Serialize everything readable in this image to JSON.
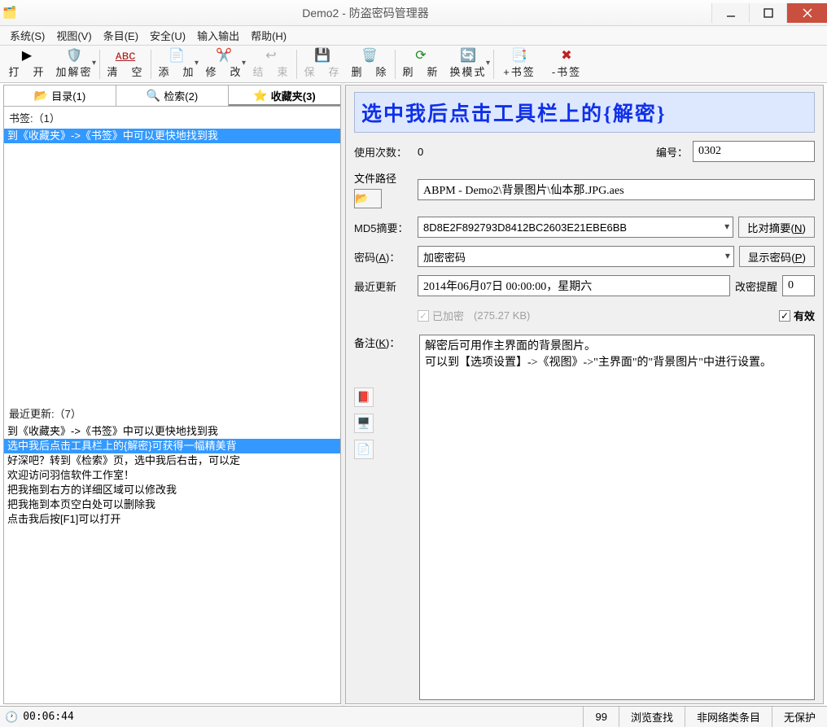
{
  "window": {
    "title": "Demo2 - 防盗密码管理器"
  },
  "menu": {
    "system": "系统(S)",
    "view": "视图(V)",
    "entry": "条目(E)",
    "security": "安全(U)",
    "io": "输入输出",
    "help": "帮助(H)"
  },
  "toolbar": {
    "open": "打　开",
    "decrypt": "加解密",
    "clear": "清　空",
    "add": "添　加",
    "modify": "修　改",
    "finish": "结　束",
    "save": "保　存",
    "delete": "删　除",
    "refresh": "刷　新",
    "switch": "换模式",
    "addbm": "+书签",
    "rembm": "-书签"
  },
  "tabs": {
    "dir": "目录(1)",
    "search": "检索(2)",
    "fav": "收藏夹(3)"
  },
  "left": {
    "bookmark_label": "书签:（1）",
    "bookmark_items": [
      "到《收藏夹》->《书签》中可以更快地找到我"
    ],
    "recent_label": "最近更新:（7）",
    "recent_items": [
      "到《收藏夹》->《书签》中可以更快地找到我",
      "选中我后点击工具栏上的{解密}可获得一幅精美背",
      "好深吧？转到《检索》页，选中我后右击，可以定",
      "欢迎访问羽信软件工作室！",
      "把我拖到右方的详细区域可以修改我",
      "把我拖到本页空白处可以删除我",
      "点击我后按[F1]可以打开"
    ],
    "recent_selected_index": 1
  },
  "detail": {
    "title": "选中我后点击工具栏上的{解密}",
    "usage_label": "使用次数：",
    "usage_value": "0",
    "id_label": "编号：",
    "id_value": "0302",
    "path_label": "文件路径",
    "path_value": "ABPM - Demo2\\背景图片\\仙本那.JPG.aes",
    "md5_label": "MD5摘要：",
    "md5_value": "8D8E2F892793D8412BC2603E21EBE6BB",
    "compare_label": "比对摘要(N)",
    "pwd_label": "密码(A)：",
    "pwd_value": "加密密码",
    "showpwd_label": "显示密码(P)",
    "lastupdate_label": "最近更新",
    "lastupdate_value": "2014年06月07日 00:00:00，星期六",
    "remind_label": "改密提醒",
    "remind_value": "0",
    "encrypted_label": "已加密",
    "encrypted_size": "(275.27 KB)",
    "valid_label": "有效",
    "remark_label": "备注(K)：",
    "remark_value": "解密后可用作主界面的背景图片。\n可以到【选项设置】->《视图》->\"主界面\"的\"背景图片\"中进行设置。"
  },
  "status": {
    "timer": "00:06:44",
    "count": "99",
    "browse": "浏览查找",
    "category": "非网络类条目",
    "protect": "无保护"
  }
}
